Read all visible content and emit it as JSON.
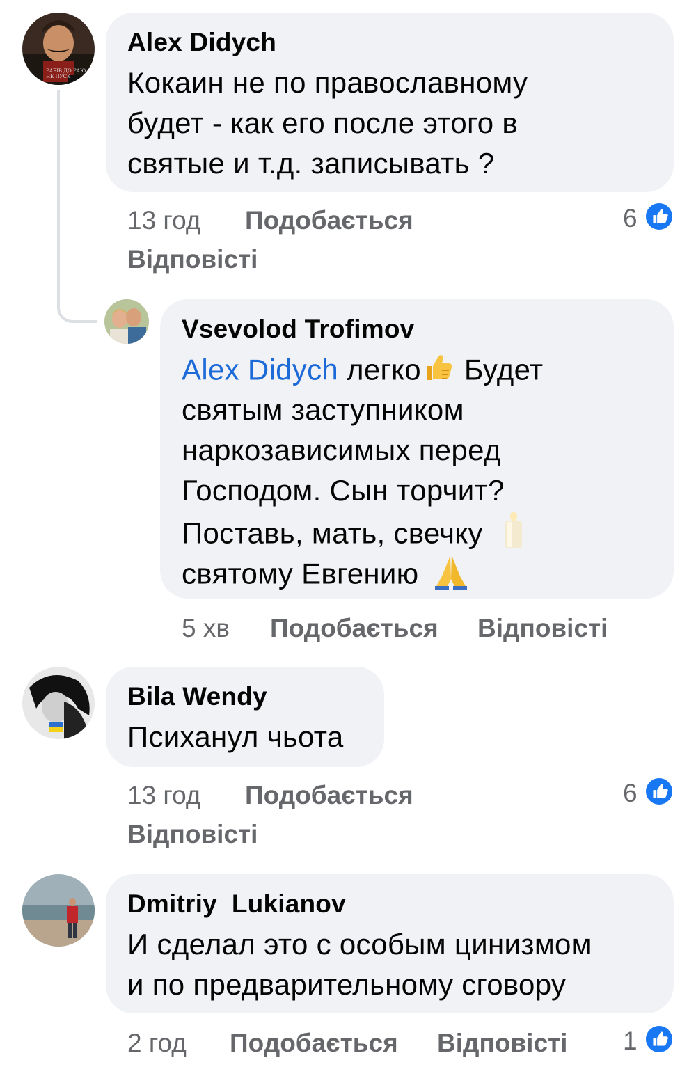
{
  "comments": [
    {
      "author": "Alex Didych",
      "lines": [
        "Кокаин не по православному",
        "будет - как его после этого в",
        "святые и т.д. записывать ?"
      ],
      "time": "13 год",
      "like_label": "Подобається",
      "reply_label": "Відповісті",
      "likes": "6",
      "avatar_caption": "РАБІВ ДО РАЮ НЕ ПУСК"
    },
    {
      "author": "Vsevolod Trofimov",
      "mention": "Alex Didych",
      "line1_text": "легко",
      "line1_tail": "Будет",
      "lines": [
        "святым заступником",
        "наркозависимых перед",
        "Господом. Сын торчит?",
        "Поставь, мать, свечку",
        "святому Евгению"
      ],
      "emoji_thumbs": "thumbs-up-emoji",
      "emoji_candle": "candle-emoji",
      "emoji_pray": "folded-hands-emoji",
      "time": "5 хв",
      "like_label": "Подобається",
      "reply_label": "Відповісті"
    },
    {
      "author": "Bila Wendy",
      "lines": [
        "Психанул чьота"
      ],
      "time": "13 год",
      "like_label": "Подобається",
      "reply_label": "Відповісті",
      "likes": "6"
    },
    {
      "author": "Dmitriy  Lukianov",
      "lines": [
        "И сделал это с особым цинизмом",
        "и по предварительному сговору"
      ],
      "time": "2 год",
      "like_label": "Подобається",
      "reply_label": "Відповісті",
      "likes": "1"
    }
  ],
  "colors": {
    "bubble": "#f0f2f5",
    "mention": "#1c6ad8",
    "meta": "#65676b",
    "like_badge": "#1877f2"
  }
}
